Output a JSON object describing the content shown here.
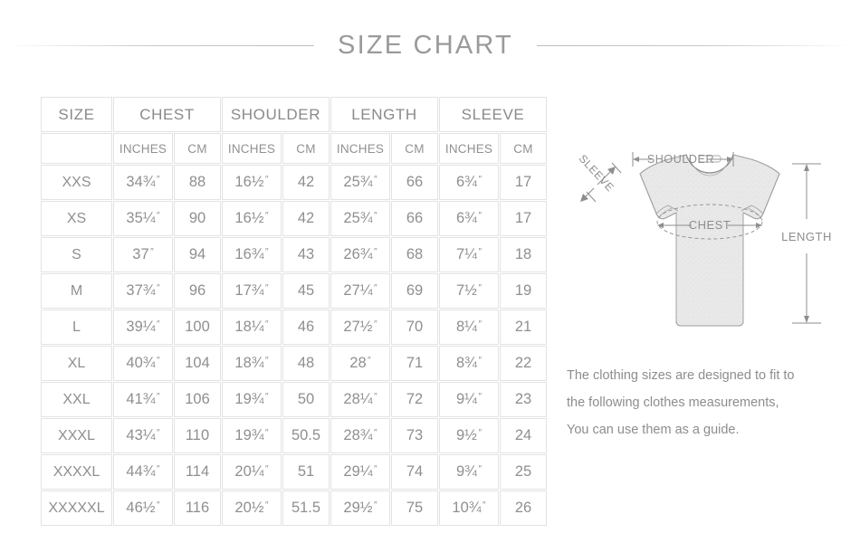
{
  "title": "SIZE  CHART",
  "table": {
    "group_headers": [
      "SIZE",
      "CHEST",
      "SHOULDER",
      "LENGTH",
      "SLEEVE"
    ],
    "unit_headers": [
      "",
      "INCHES",
      "CM",
      "INCHES",
      "CM",
      "INCHES",
      "CM",
      "INCHES",
      "CM"
    ],
    "rows": [
      {
        "size": "XXS",
        "chest_in": "34¾",
        "chest_cm": "88",
        "shoulder_in": "16½",
        "shoulder_cm": "42",
        "length_in": "25¾",
        "length_cm": "66",
        "sleeve_in": "6¾",
        "sleeve_cm": "17"
      },
      {
        "size": "XS",
        "chest_in": "35¼",
        "chest_cm": "90",
        "shoulder_in": "16½",
        "shoulder_cm": "42",
        "length_in": "25¾",
        "length_cm": "66",
        "sleeve_in": "6¾",
        "sleeve_cm": "17"
      },
      {
        "size": "S",
        "chest_in": "37",
        "chest_cm": "94",
        "shoulder_in": "16¾",
        "shoulder_cm": "43",
        "length_in": "26¾",
        "length_cm": "68",
        "sleeve_in": "7¼",
        "sleeve_cm": "18"
      },
      {
        "size": "M",
        "chest_in": "37¾",
        "chest_cm": "96",
        "shoulder_in": "17¾",
        "shoulder_cm": "45",
        "length_in": "27¼",
        "length_cm": "69",
        "sleeve_in": "7½",
        "sleeve_cm": "19"
      },
      {
        "size": "L",
        "chest_in": "39¼",
        "chest_cm": "100",
        "shoulder_in": "18¼",
        "shoulder_cm": "46",
        "length_in": "27½",
        "length_cm": "70",
        "sleeve_in": "8¼",
        "sleeve_cm": "21"
      },
      {
        "size": "XL",
        "chest_in": "40¾",
        "chest_cm": "104",
        "shoulder_in": "18¾",
        "shoulder_cm": "48",
        "length_in": "28",
        "length_cm": "71",
        "sleeve_in": "8¾",
        "sleeve_cm": "22"
      },
      {
        "size": "XXL",
        "chest_in": "41¾",
        "chest_cm": "106",
        "shoulder_in": "19¾",
        "shoulder_cm": "50",
        "length_in": "28¼",
        "length_cm": "72",
        "sleeve_in": "9¼",
        "sleeve_cm": "23"
      },
      {
        "size": "XXXL",
        "chest_in": "43¼",
        "chest_cm": "110",
        "shoulder_in": "19¾",
        "shoulder_cm": "50.5",
        "length_in": "28¾",
        "length_cm": "73",
        "sleeve_in": "9½",
        "sleeve_cm": "24"
      },
      {
        "size": "XXXXL",
        "chest_in": "44¾",
        "chest_cm": "114",
        "shoulder_in": "20¼",
        "shoulder_cm": "51",
        "length_in": "29¼",
        "length_cm": "74",
        "sleeve_in": "9¾",
        "sleeve_cm": "25"
      },
      {
        "size": "XXXXXL",
        "chest_in": "46½",
        "chest_cm": "116",
        "shoulder_in": "20½",
        "shoulder_cm": "51.5",
        "length_in": "29½",
        "length_cm": "75",
        "sleeve_in": "10¾",
        "sleeve_cm": "26"
      }
    ],
    "inch_mark": "″"
  },
  "diagram": {
    "labels": {
      "shoulder": "SHOULDER",
      "sleeve": "SLEEVE",
      "chest": "CHEST",
      "length": "LENGTH"
    }
  },
  "caption": {
    "line1": "The clothing sizes are designed to fit to",
    "line2": "the following clothes measurements,",
    "line3": "You can use them as a guide."
  },
  "colors": {
    "text": "#8f8f8f",
    "title": "#9a9a9a",
    "grid": "#e3e3e3",
    "shirt_fill": "#e9e9e9",
    "shirt_stroke": "#9d9d9d",
    "background": "#ffffff"
  }
}
